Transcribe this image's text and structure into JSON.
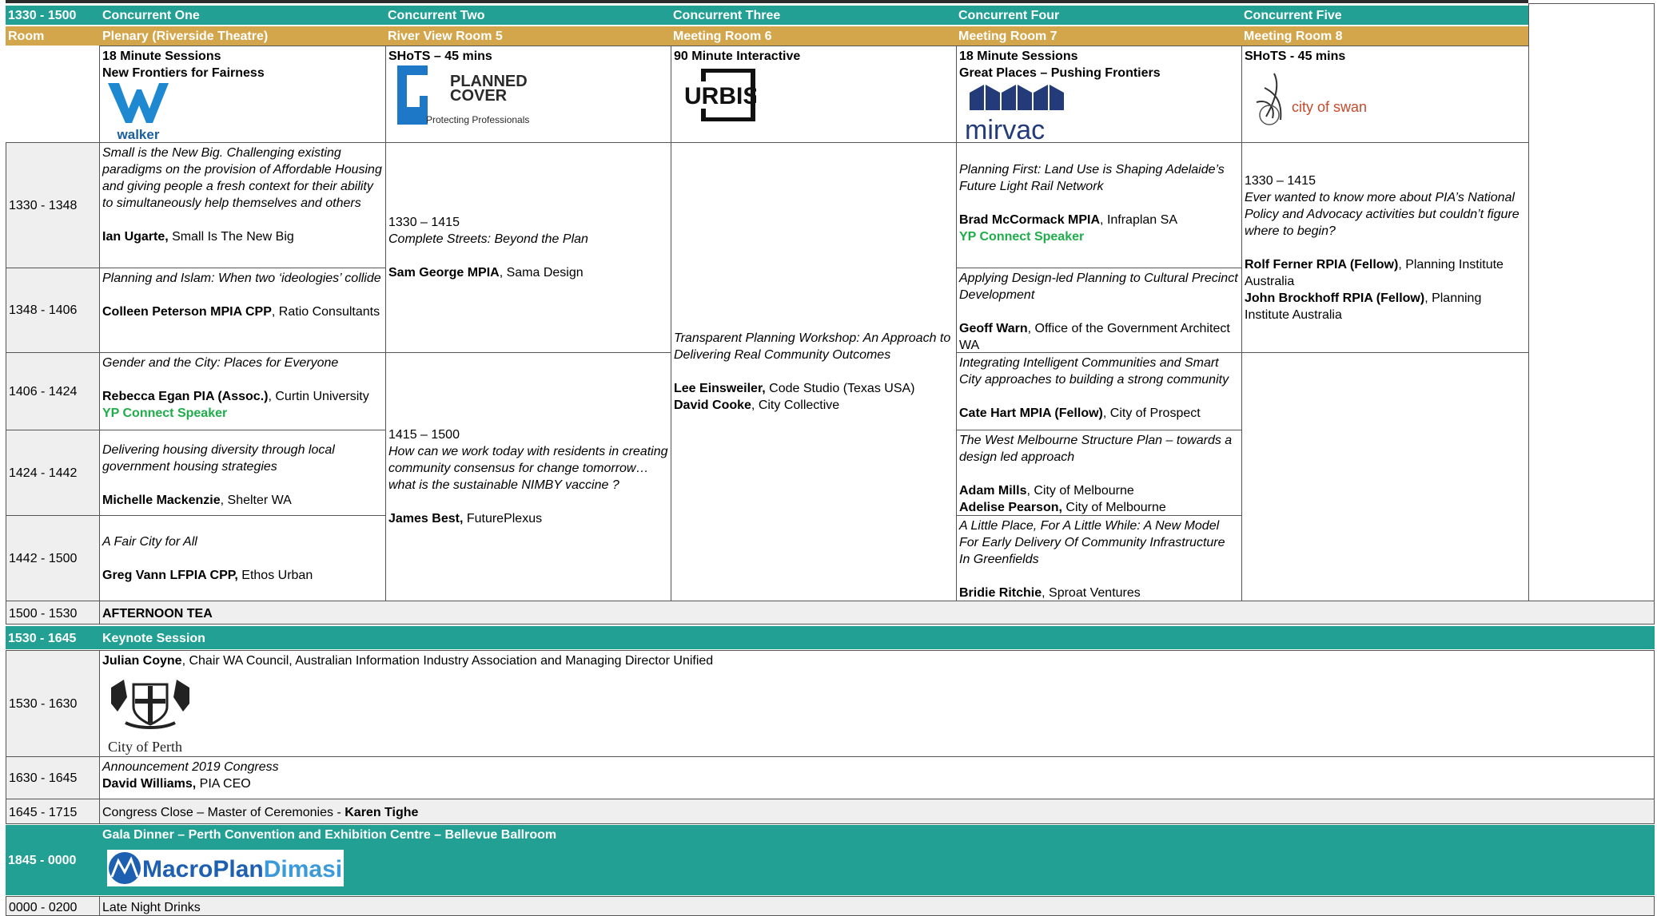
{
  "header": {
    "time": "1330 - 1500",
    "room_label": "Room",
    "streams": [
      {
        "name": "Concurrent One",
        "room": "Plenary (Riverside Theatre)",
        "format": "18 Minute Sessions",
        "theme": "New Frontiers for Fairness",
        "sponsor": "walker"
      },
      {
        "name": "Concurrent Two",
        "room": "River View Room 5",
        "format": "SHoTS – 45 mins",
        "theme": "",
        "sponsor": "PLANNED COVER",
        "sponsor_line2": "COVER",
        "sponsor_line1": "PLANNED",
        "sponsor_tagline": "Protecting Professionals"
      },
      {
        "name": "Concurrent Three",
        "room": "Meeting Room 6",
        "format": "90 Minute Interactive",
        "theme": "",
        "sponsor": "URBIS"
      },
      {
        "name": "Concurrent Four",
        "room": "Meeting Room 7",
        "format": "18 Minute Sessions",
        "theme": "Great Places – Pushing Frontiers",
        "sponsor": "mirvac"
      },
      {
        "name": "Concurrent Five",
        "room": "Meeting Room 8",
        "format": "SHoTS - 45 mins",
        "theme": "",
        "sponsor": "city of swan"
      }
    ]
  },
  "slots": [
    "1330 - 1348",
    "1348 - 1406",
    "1406 - 1424",
    "1424 - 1442",
    "1442 - 1500"
  ],
  "c1": [
    {
      "title": "Small is the New Big. Challenging existing paradigms on the provision of Affordable Housing and giving people a fresh context for their ability to simultaneously help themselves and others",
      "speaker": "Ian Ugarte,",
      "org": " Small Is The New Big"
    },
    {
      "title": "Planning and Islam: When two ‘ideologies’ collide",
      "speaker": "Colleen Peterson MPIA CPP",
      "org": ", Ratio Consultants"
    },
    {
      "title": "Gender and the City: Places for Everyone",
      "speaker": "Rebecca Egan PIA (Assoc.)",
      "org": ", Curtin University",
      "badge": "YP Connect Speaker"
    },
    {
      "title": "Delivering housing diversity through local government housing strategies",
      "speaker": "Michelle Mackenzie",
      "org": ", Shelter WA"
    },
    {
      "title": "A Fair City for All",
      "speaker": "Greg Vann LFPIA CPP,",
      "org": " Ethos Urban"
    }
  ],
  "c2": [
    {
      "time": "1330 – 1415",
      "title": "Complete Streets: Beyond the Plan",
      "speaker": "Sam George MPIA",
      "org": ", Sama Design"
    },
    {
      "time": "1415 – 1500",
      "title": "How can we work today with residents in creating community consensus for change tomorrow… what is the sustainable NIMBY vaccine ?",
      "speaker": "James Best,",
      "org": " FuturePlexus"
    }
  ],
  "c3": {
    "title": "Transparent Planning Workshop: An Approach to Delivering Real Community Outcomes",
    "speaker1": "Lee Einsweiler,",
    "org1": " Code Studio (Texas USA)",
    "speaker2": "David Cooke",
    "org2": ", City Collective"
  },
  "c4": [
    {
      "title": "Planning First: Land Use is Shaping Adelaide’s Future Light Rail Network",
      "speaker": "Brad McCormack MPIA",
      "org": ", Infraplan SA",
      "badge": "YP Connect Speaker"
    },
    {
      "title": "Applying Design-led Planning to Cultural Precinct Development",
      "speaker": "Geoff Warn",
      "org": ", Office of the Government Architect WA"
    },
    {
      "title": "Integrating Intelligent Communities and Smart City approaches to building a strong community",
      "speaker": "Cate Hart MPIA (Fellow)",
      "org": ", City of Prospect"
    },
    {
      "title": "The West Melbourne Structure Plan – towards a design led approach",
      "speaker": "Adam Mills",
      "org": ", City of Melbourne",
      "speaker2": "Adelise Pearson,",
      "org2": " City of Melbourne"
    },
    {
      "title": "A Little Place, For A Little While: A New Model For Early Delivery Of Community Infrastructure In Greenfields",
      "speaker": "Bridie Ritchie",
      "org": ", Sproat Ventures"
    }
  ],
  "c5": {
    "time": "1330 – 1415",
    "title": "Ever wanted to know more about PIA’s National Policy and Advocacy activities but couldn’t figure where to begin?",
    "speaker1": "Rolf Ferner RPIA (Fellow)",
    "org1": ", Planning Institute Australia",
    "speaker2": "John Brockhoff RPIA (Fellow)",
    "org2": ", Planning Institute Australia"
  },
  "afternoon_tea": {
    "time": "1500 -  1530",
    "label": "AFTERNOON TEA"
  },
  "keynote": {
    "time": "1530 - 1645",
    "label": "Keynote Session"
  },
  "keynote_talk": {
    "time": "1530 - 1630",
    "speaker": "Julian Coyne",
    "org": ", Chair WA Council, Australian Information Industry Association and Managing Director Unified",
    "sponsor_city": "City of ",
    "sponsor_city_bold": "Perth"
  },
  "announcement": {
    "time": "1630 - 1645",
    "title": "Announcement 2019 Congress",
    "speaker": "David Williams,",
    "org": " PIA CEO"
  },
  "close": {
    "time": "1645 - 1715",
    "text": "Congress Close – Master of Ceremonies - ",
    "mc": "Karen Tighe"
  },
  "gala": {
    "time": "1845 - 0000",
    "title": "Gala Dinner – Perth Convention and Exhibition Centre – Bellevue Ballroom",
    "sponsor1": "MacroPlan",
    "sponsor2": "Dimasi"
  },
  "late": {
    "time": "0000 - 0200",
    "text": "Late Night Drinks"
  },
  "colors": {
    "teal": "#21a093",
    "gold": "#d4a64c",
    "green": "#1fad4b",
    "walker": "#1e88d0",
    "mirvac": "#243b7a"
  }
}
